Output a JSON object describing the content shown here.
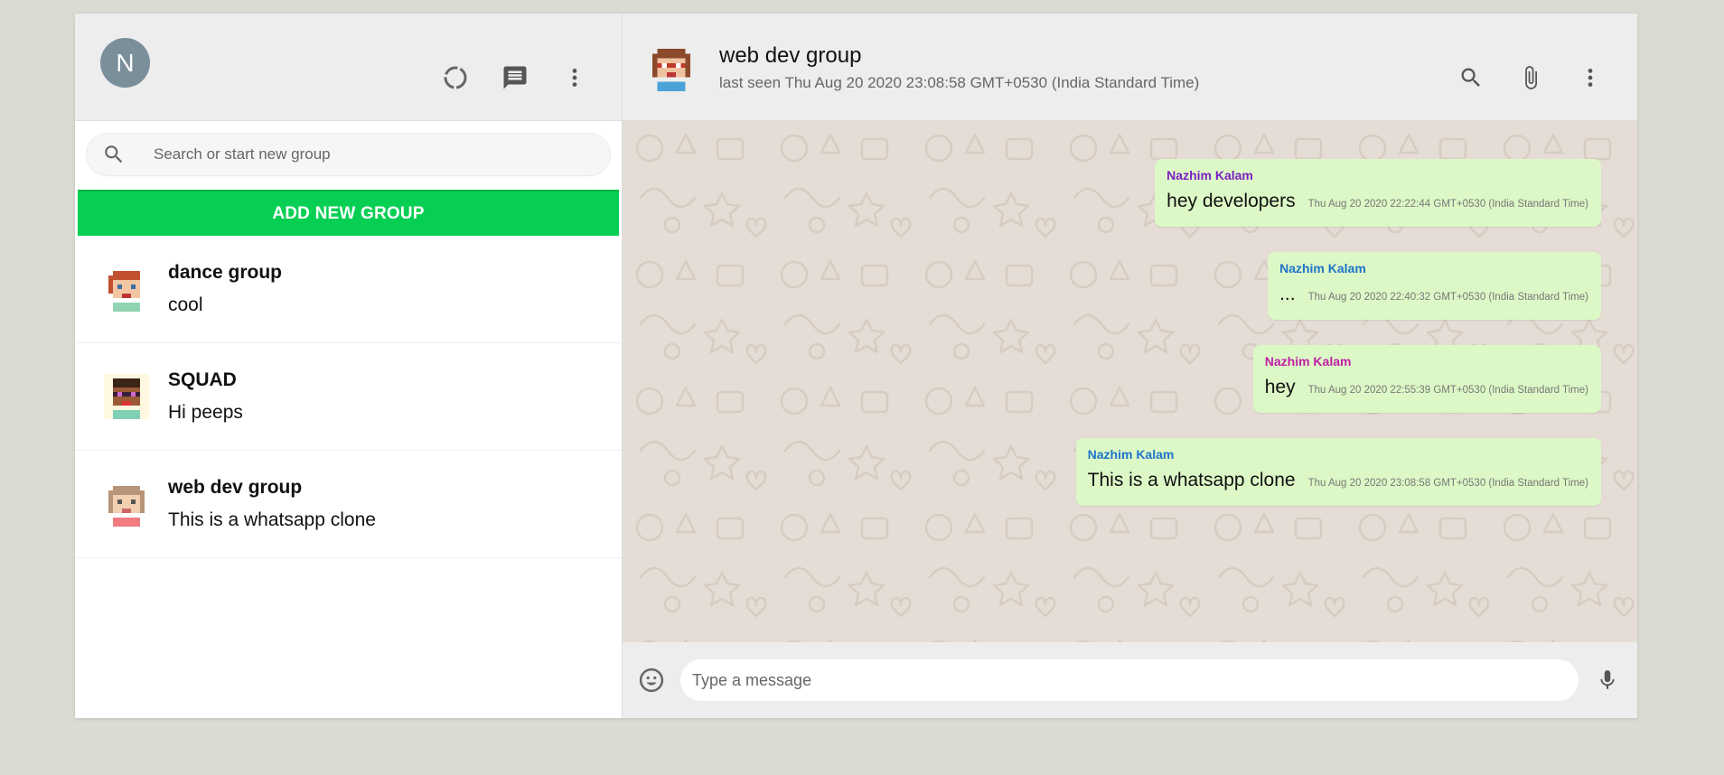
{
  "sidebar": {
    "user_initial": "N",
    "search_placeholder": "Search or start new group",
    "add_group_label": "ADD NEW GROUP",
    "chats": [
      {
        "name": "dance group",
        "last_message": "cool"
      },
      {
        "name": "SQUAD",
        "last_message": "Hi peeps"
      },
      {
        "name": "web dev group",
        "last_message": "This is a whatsapp clone"
      }
    ]
  },
  "chat": {
    "title": "web dev group",
    "subtitle": "last seen Thu Aug 20 2020 23:08:58 GMT+0530 (India Standard Time)",
    "messages": [
      {
        "sender": "Nazhim Kalam",
        "sender_color": "#7b1fc4",
        "text": "hey developers",
        "time": "Thu Aug 20 2020 22:22:44 GMT+0530 (India Standard Time)"
      },
      {
        "sender": "Nazhim Kalam",
        "sender_color": "#1e74c9",
        "text": "...",
        "time": "Thu Aug 20 2020 22:40:32 GMT+0530 (India Standard Time)"
      },
      {
        "sender": "Nazhim Kalam",
        "sender_color": "#c21ea6",
        "text": "hey",
        "time": "Thu Aug 20 2020 22:55:39 GMT+0530 (India Standard Time)"
      },
      {
        "sender": "Nazhim Kalam",
        "sender_color": "#1e74c9",
        "text": "This is a whatsapp clone",
        "time": "Thu Aug 20 2020 23:08:58 GMT+0530 (India Standard Time)"
      }
    ],
    "composer_placeholder": "Type a message"
  },
  "icons": {
    "status": "status-icon",
    "new_chat": "chat-icon",
    "menu": "more-vert-icon",
    "search": "search-icon",
    "attach": "attach-icon",
    "emoji": "emoji-icon",
    "mic": "mic-icon"
  },
  "colors": {
    "accent_green": "#06cf53",
    "bubble": "#dcf8c6",
    "header_bg": "#ededed",
    "chat_bg": "#e5ddd5"
  }
}
